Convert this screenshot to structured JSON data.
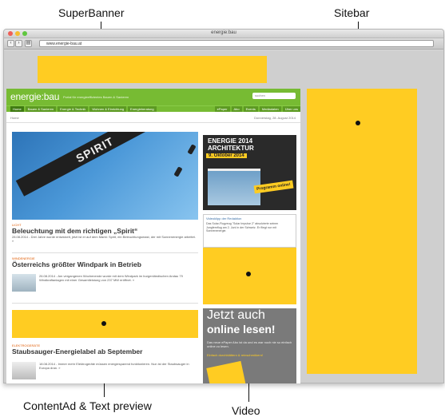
{
  "callouts": {
    "superbanner": "SuperBanner",
    "sitebar": "Sitebar",
    "contentad": "ContentAd & Text preview",
    "video": "Video"
  },
  "browser": {
    "title": "energie:bau",
    "url": "www.energie-bau.at"
  },
  "site": {
    "logo": "energie:bau",
    "tagline": "Portal für energieeffizientes Bauen & Sanieren",
    "search_placeholder": "suchen",
    "nav": [
      "Home",
      "Bauen & Sanieren",
      "Energie & Technik",
      "Wohnen & Einrichtung",
      "Energieberatung"
    ],
    "nav_right": [
      "ePaper",
      "Abo",
      "Events",
      "Mediadaten",
      "Über uns"
    ],
    "breadcrumb": "Home",
    "date": "Donnerstag, 28. August 2014"
  },
  "hero": {
    "text": "SPIRIT"
  },
  "articles": [
    {
      "category": "Licht",
      "title": "Beleuchtung mit dem richtigen „Spirit“",
      "teaser": "28.08.2014 - Drei Jahre wurde entwickelt, jetzt ist er auf dem Markt: Spirit, ein Beleuchtungsmast, der mit Sonnenenergie arbeitet. »"
    },
    {
      "category": "Windenergie",
      "title": "Österreichs größter Windpark in Betrieb",
      "teaser": "26.08.2014 - Am vergangenen Wochenende wurde mit dem Windpark im burgenländischen Andau 79 Windkraftanlagen mit einer Gesamtleistung von 237 MW eröffnet. »"
    },
    {
      "category": "Elektrogeräte",
      "title": "Staubsauger-Energielabel ab September",
      "teaser": "18.08.2014 - Immer mehr Elektrogeräte müssen energiesparend funktionieren. Nun ist der Staubsauger in Europa dran. »"
    }
  ],
  "promo": {
    "line1": "ENERGIE 2014",
    "line2": "ARCHITEKTUR",
    "date": "9. Oktober 2014",
    "badge": "Programm online!"
  },
  "video_box": {
    "heading": "Videoklipp der Redaktion",
    "text": "Das Solar-Flugzeug \"Solar Impulse 2\" absolvierte seinen Jungfernflug am 2. Juni in der Schweiz. Er fliegt nur mit Sonnenenergie."
  },
  "epaper": {
    "line1": "Jetzt auch",
    "line2": "online lesen!",
    "text": "Das neue ePaper Abo ist da und es war noch nie so einfach online zu lesen.",
    "link": "Einfach durchblättern & reinschmökern!"
  },
  "colors": {
    "ad_yellow": "#ffcc22",
    "brand_green": "#77bb33"
  }
}
